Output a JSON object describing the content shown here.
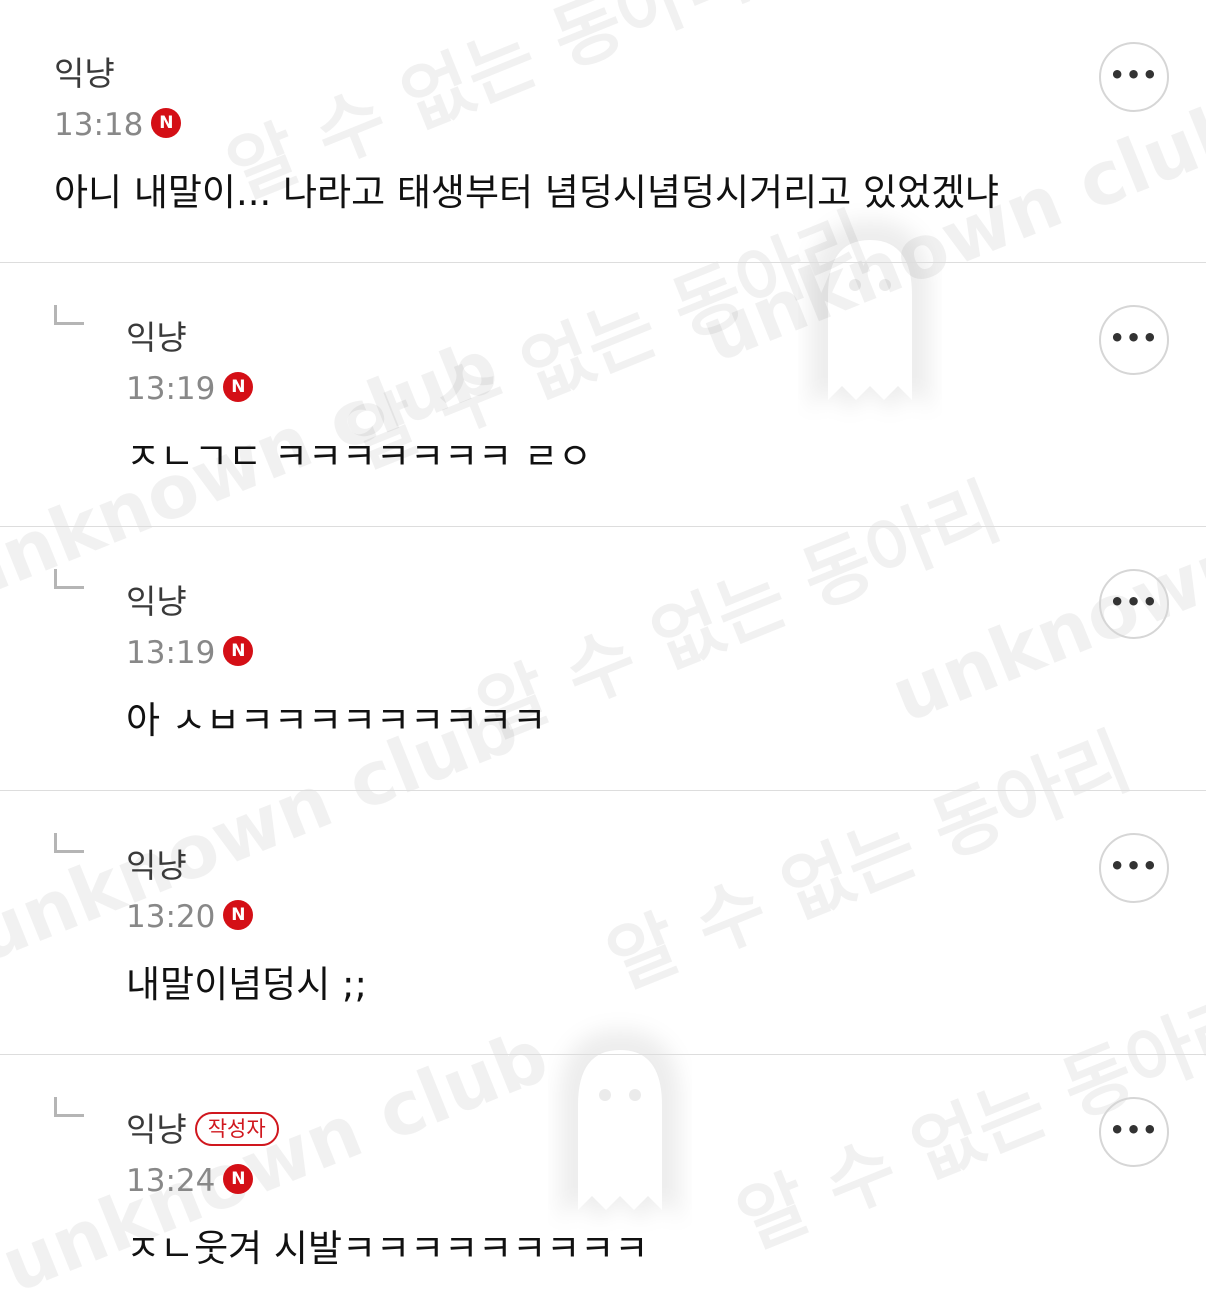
{
  "comments": [
    {
      "author": "익냥",
      "badge": "",
      "time": "13:18",
      "new_badge": "N",
      "text": "아니 내말이... 나라고 태생부터 념덩시념덩시거리고 있었겠냐",
      "more_label": "•••"
    },
    {
      "author": "익냥",
      "badge": "",
      "time": "13:19",
      "new_badge": "N",
      "text": "ㅈㄴㄱㄷ ㅋㅋㅋㅋㅋㅋㅋ ㄹㅇ",
      "more_label": "•••"
    },
    {
      "author": "익냥",
      "badge": "",
      "time": "13:19",
      "new_badge": "N",
      "text": "아 ㅅㅂㅋㅋㅋㅋㅋㅋㅋㅋㅋ",
      "more_label": "•••"
    },
    {
      "author": "익냥",
      "badge": "",
      "time": "13:20",
      "new_badge": "N",
      "text": "내말이념덩시 ;;",
      "more_label": "•••"
    },
    {
      "author": "익냥",
      "badge": "작성자",
      "time": "13:24",
      "new_badge": "N",
      "text": "ㅈㄴ웃겨 시발ㅋㅋㅋㅋㅋㅋㅋㅋㅋ",
      "more_label": "•••"
    }
  ],
  "watermark": {
    "text_ko": "알 수 없는 동아리",
    "text_en": "unknown club"
  },
  "colors": {
    "new_badge": "#d40f16",
    "author_badge": "#d0171e",
    "divider": "#dddddd",
    "time": "#888888"
  }
}
